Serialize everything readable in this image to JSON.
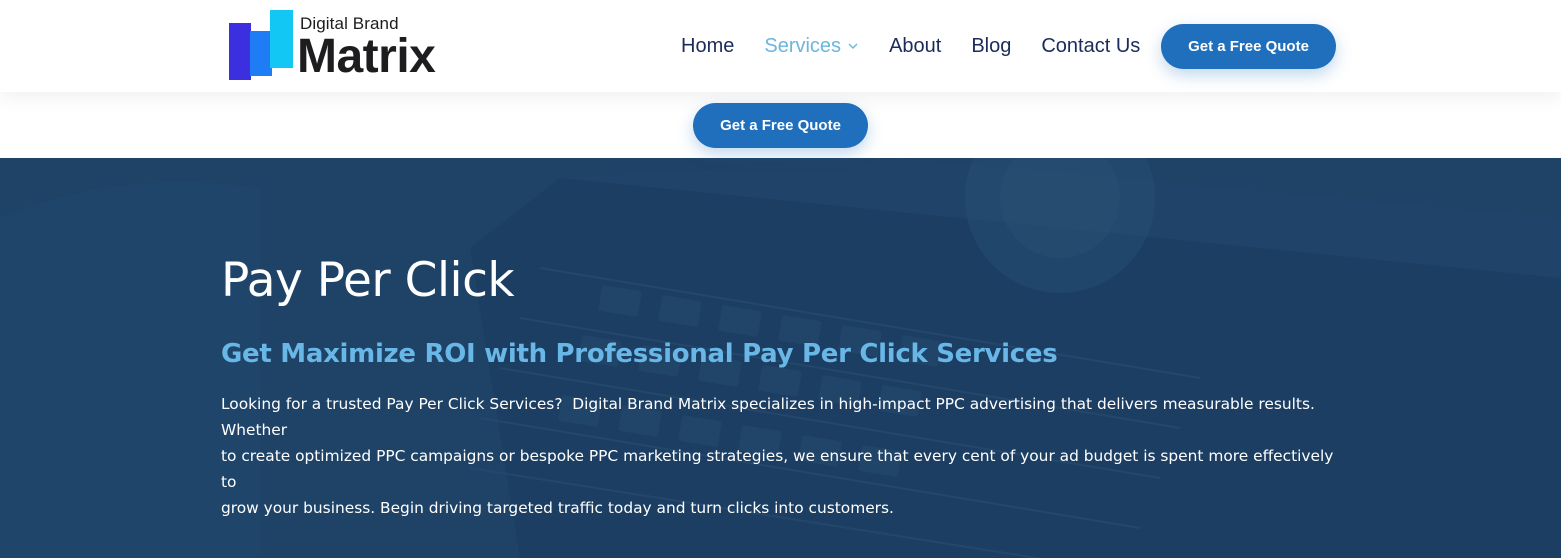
{
  "header": {
    "logo": {
      "small_text": "Digital Brand",
      "big_text": "Matrix",
      "colors": [
        "#3b2fe0",
        "#1e7cf5",
        "#12c7f4"
      ]
    },
    "nav": [
      {
        "label": "Home"
      },
      {
        "label": "Services",
        "active": true,
        "icon": "chevron-down-icon"
      },
      {
        "label": "About"
      },
      {
        "label": "Blog"
      },
      {
        "label": "Contact Us"
      }
    ],
    "cta_label": "Get a Free Quote"
  },
  "subbar": {
    "cta_label": "Get a Free Quote"
  },
  "hero": {
    "title": "Pay Per Click",
    "subtitle": "Get Maximize ROI with Professional Pay Per Click Services",
    "body": "Looking for a trusted Pay Per Click Services?  Digital Brand Matrix specializes in high-impact PPC advertising that delivers measurable results. Whether\nto create optimized PPC campaigns or bespoke PPC marketing strategies, we ensure that every cent of your ad budget is spent more effectively to\ngrow your business. Begin driving targeted traffic today and turn clicks into customers."
  },
  "colors": {
    "brand_blue": "#1f6fbd",
    "nav_text": "#1b2c5a",
    "nav_active": "#6bb6dc",
    "hero_bg": "#1f4267",
    "hero_subtitle": "#68b7e6"
  }
}
